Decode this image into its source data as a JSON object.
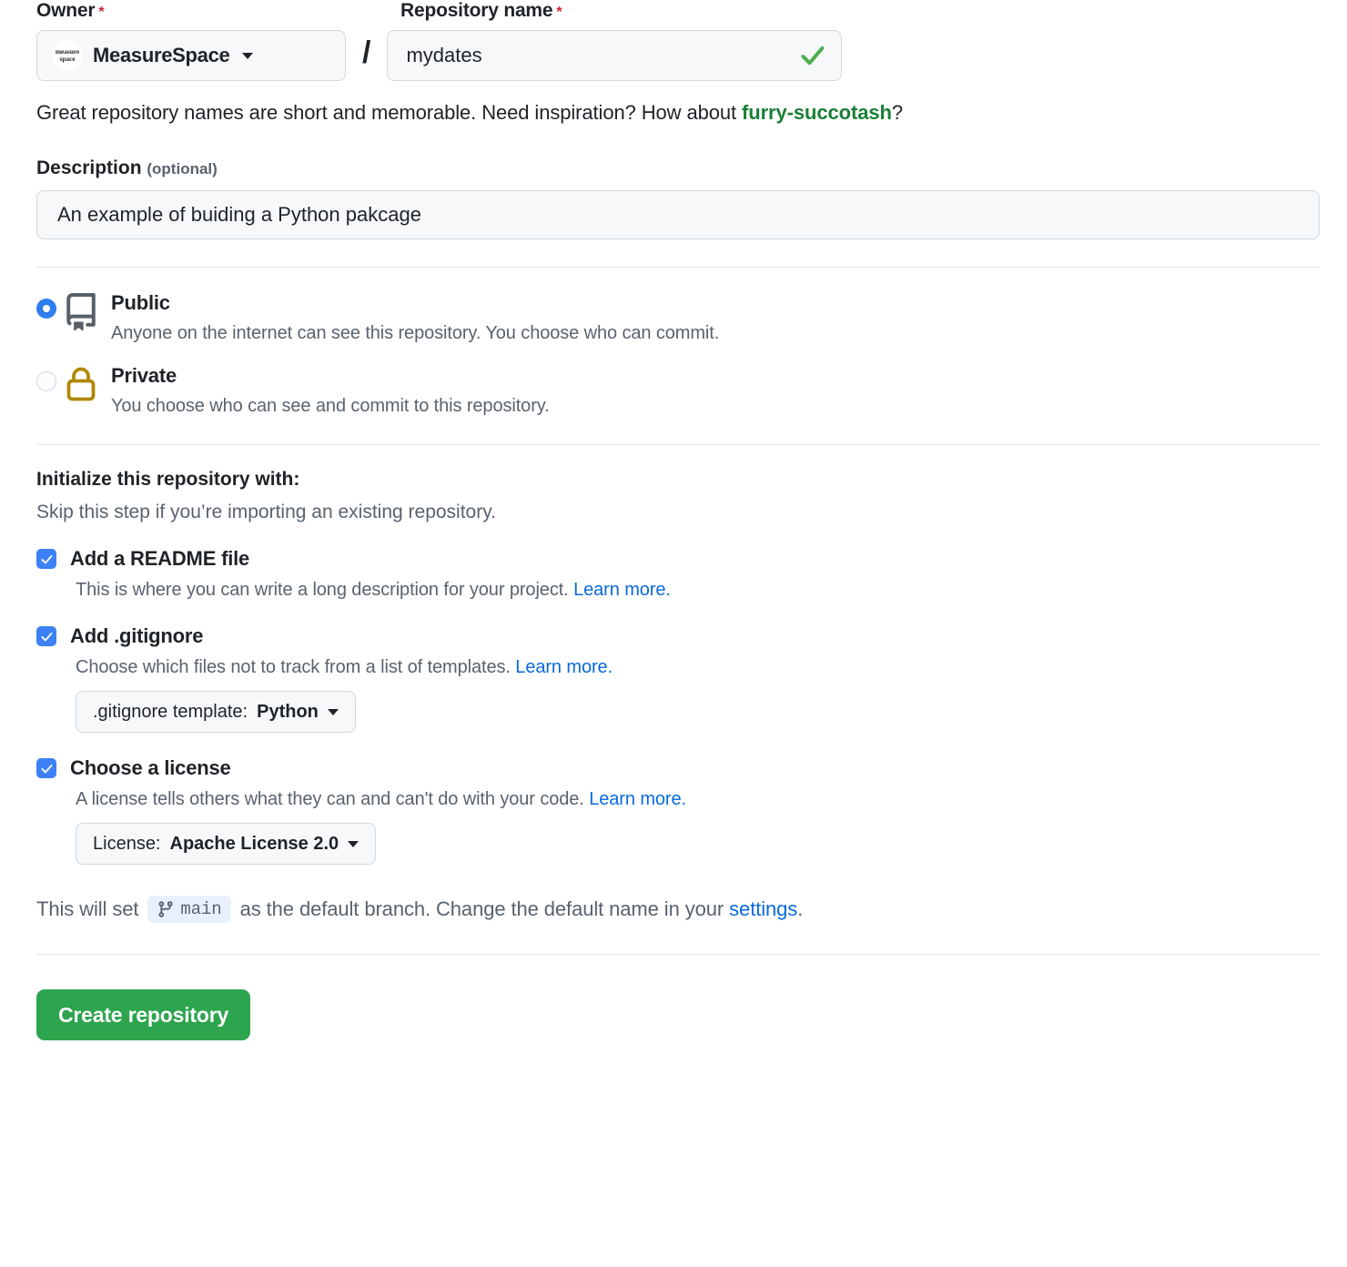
{
  "form": {
    "owner": {
      "label": "Owner",
      "required_marker": "*",
      "avatar_line1": "measure",
      "avatar_line2": "space",
      "value": "MeasureSpace"
    },
    "separator": "/",
    "repository_name": {
      "label": "Repository name",
      "required_marker": "*",
      "value": "mydates",
      "placeholder": "",
      "validation_state": "valid"
    },
    "name_hint": {
      "prefix": "Great repository names are short and memorable. Need inspiration? How about ",
      "suggestion": "furry-succotash",
      "suffix": "?"
    },
    "description": {
      "label": "Description",
      "optional_note": "(optional)",
      "value": "An example of buiding a Python pakcage",
      "placeholder": ""
    },
    "visibility": {
      "options": [
        {
          "id": "public",
          "title": "Public",
          "description": "Anyone on the internet can see this repository. You choose who can commit.",
          "selected": true,
          "icon": "repo-icon"
        },
        {
          "id": "private",
          "title": "Private",
          "description": "You choose who can see and commit to this repository.",
          "selected": false,
          "icon": "lock-icon"
        }
      ]
    },
    "initialize": {
      "title": "Initialize this repository with:",
      "subtitle": "Skip this step if you’re importing an existing repository.",
      "options": [
        {
          "id": "readme",
          "label": "Add a README file",
          "description": "This is where you can write a long description for your project. ",
          "link_text": "Learn more.",
          "checked": true,
          "dropdown": null
        },
        {
          "id": "gitignore",
          "label": "Add .gitignore",
          "description": "Choose which files not to track from a list of templates. ",
          "link_text": "Learn more.",
          "checked": true,
          "dropdown": {
            "prefix": ".gitignore template:",
            "value": "Python"
          }
        },
        {
          "id": "license",
          "label": "Choose a license",
          "description": "A license tells others what they can and can't do with your code. ",
          "link_text": "Learn more.",
          "checked": true,
          "dropdown": {
            "prefix": "License:",
            "value": "Apache License 2.0"
          }
        }
      ]
    },
    "branch_note": {
      "prefix": "This will set",
      "branch_name": "main",
      "middle": "as the default branch. Change the default name in your",
      "link_text": "settings",
      "suffix": "."
    },
    "submit": {
      "label": "Create repository"
    }
  },
  "colors": {
    "accent_green": "#2da44e",
    "suggestion_green": "#1a7f37",
    "link_blue": "#0969da",
    "checkbox_blue": "#3c82f6",
    "radio_blue": "#2f7ef0",
    "lock_gold": "#b08800",
    "required_red": "#cf222e",
    "muted_text": "#59636e",
    "border": "#d1d9e0",
    "field_bg": "#f6f8fa"
  }
}
